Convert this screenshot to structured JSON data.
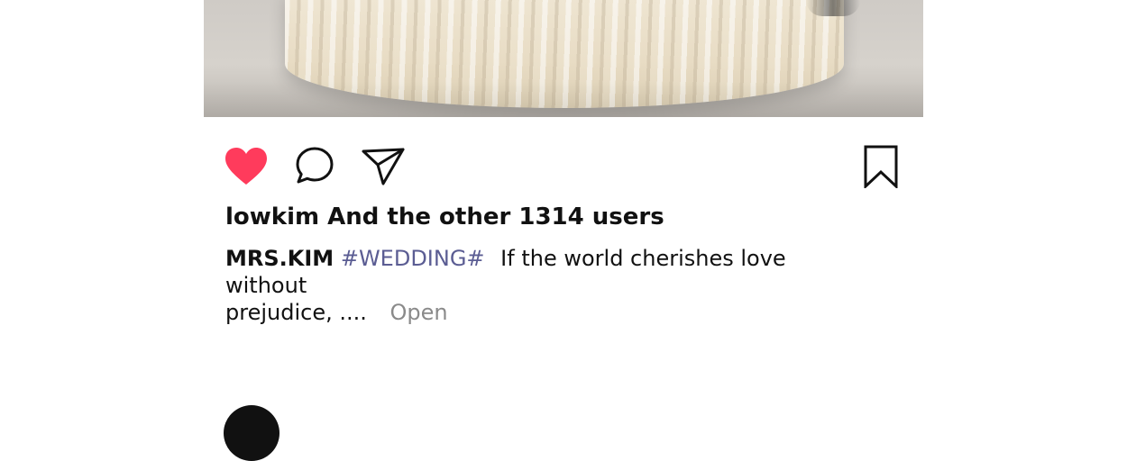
{
  "post": {
    "photo_alt": "",
    "actions": {
      "like_icon": "heart-filled-icon",
      "like_color": "#ff3b5c",
      "comment_icon": "comment-bubble-icon",
      "share_icon": "send-paper-plane-icon",
      "bookmark_icon": "bookmark-icon"
    },
    "likes_text": "lowkim And the other 1314 users",
    "caption": {
      "author": "MRS.KIM",
      "hashtag": "#WEDDING#",
      "text_line1": "If the world cherishes love without",
      "text_line2": "prejudice, ....",
      "more_label": "Open",
      "hashtag_color": "#5b5d93"
    }
  }
}
